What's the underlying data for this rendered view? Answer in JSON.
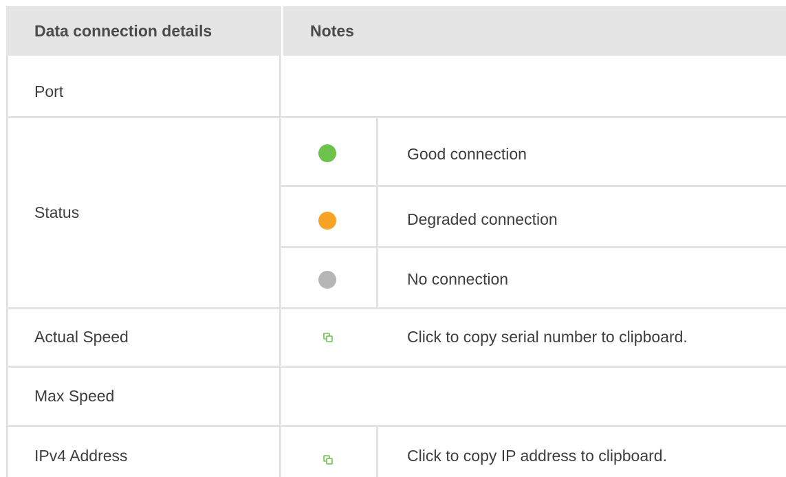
{
  "table": {
    "headers": [
      "Data connection details",
      "Notes"
    ],
    "rows": {
      "port": {
        "label": "Port"
      },
      "status": {
        "label": "Status",
        "states": [
          {
            "icon": "green-dot-icon",
            "color": "#6cc24a",
            "text": "Good connection"
          },
          {
            "icon": "orange-dot-icon",
            "color": "#f7a426",
            "text": "Degraded connection"
          },
          {
            "icon": "gray-dot-icon",
            "color": "#b6b6b6",
            "text": "No connection"
          }
        ]
      },
      "actual_speed": {
        "label": "Actual Speed",
        "icon": "copy-icon",
        "note": "Click to copy serial number to clipboard."
      },
      "max_speed": {
        "label": "Max Speed"
      },
      "ipv4": {
        "label": "IPv4 Address",
        "icon": "copy-icon",
        "note": "Click to copy IP address to clipboard."
      }
    }
  },
  "colors": {
    "header_bg": "#e5e5e5",
    "border": "#e3e3e3",
    "copy_icon": "#6cc24a"
  }
}
